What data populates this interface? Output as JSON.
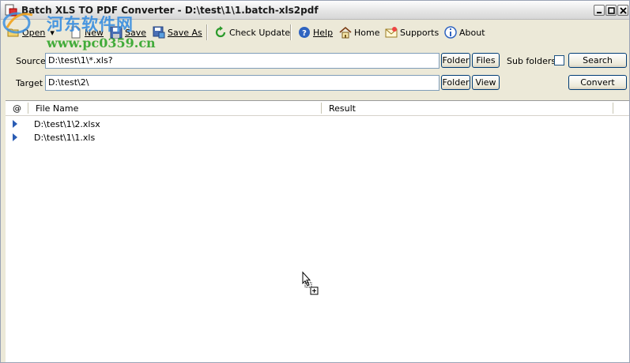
{
  "window": {
    "title": "Batch XLS TO PDF Converter - D:\\test\\1\\1.batch-xls2pdf"
  },
  "watermark": {
    "text_cn": "河东软件网",
    "url": "www.pc0359.cn"
  },
  "toolbar": {
    "open": "Open",
    "new": "New",
    "save": "Save",
    "save_as": "Save As",
    "check_update": "Check Update",
    "help": "Help",
    "home": "Home",
    "supports": "Supports",
    "about": "About"
  },
  "form": {
    "source_label": "Source",
    "source_value": "D:\\test\\1\\*.xls?",
    "target_label": "Target",
    "target_value": "D:\\test\\2\\",
    "folder_button": "Folder",
    "files_button": "Files",
    "view_button": "View",
    "sub_folders_label": "Sub folders",
    "search_button": "Search",
    "convert_button": "Convert"
  },
  "list": {
    "columns": [
      "@",
      "File Name",
      "Result"
    ],
    "rows": [
      {
        "file": "D:\\test\\1\\2.xlsx",
        "result": ""
      },
      {
        "file": "D:\\test\\1\\1.xls",
        "result": ""
      }
    ]
  },
  "icons": {
    "app": "app-icon",
    "open": "folder-open-icon",
    "new": "new-document-icon",
    "save": "floppy-icon",
    "save_as": "save-as-icon",
    "check_update": "refresh-icon",
    "help": "help-icon",
    "home": "home-icon",
    "supports": "supports-icon",
    "about": "info-icon"
  }
}
